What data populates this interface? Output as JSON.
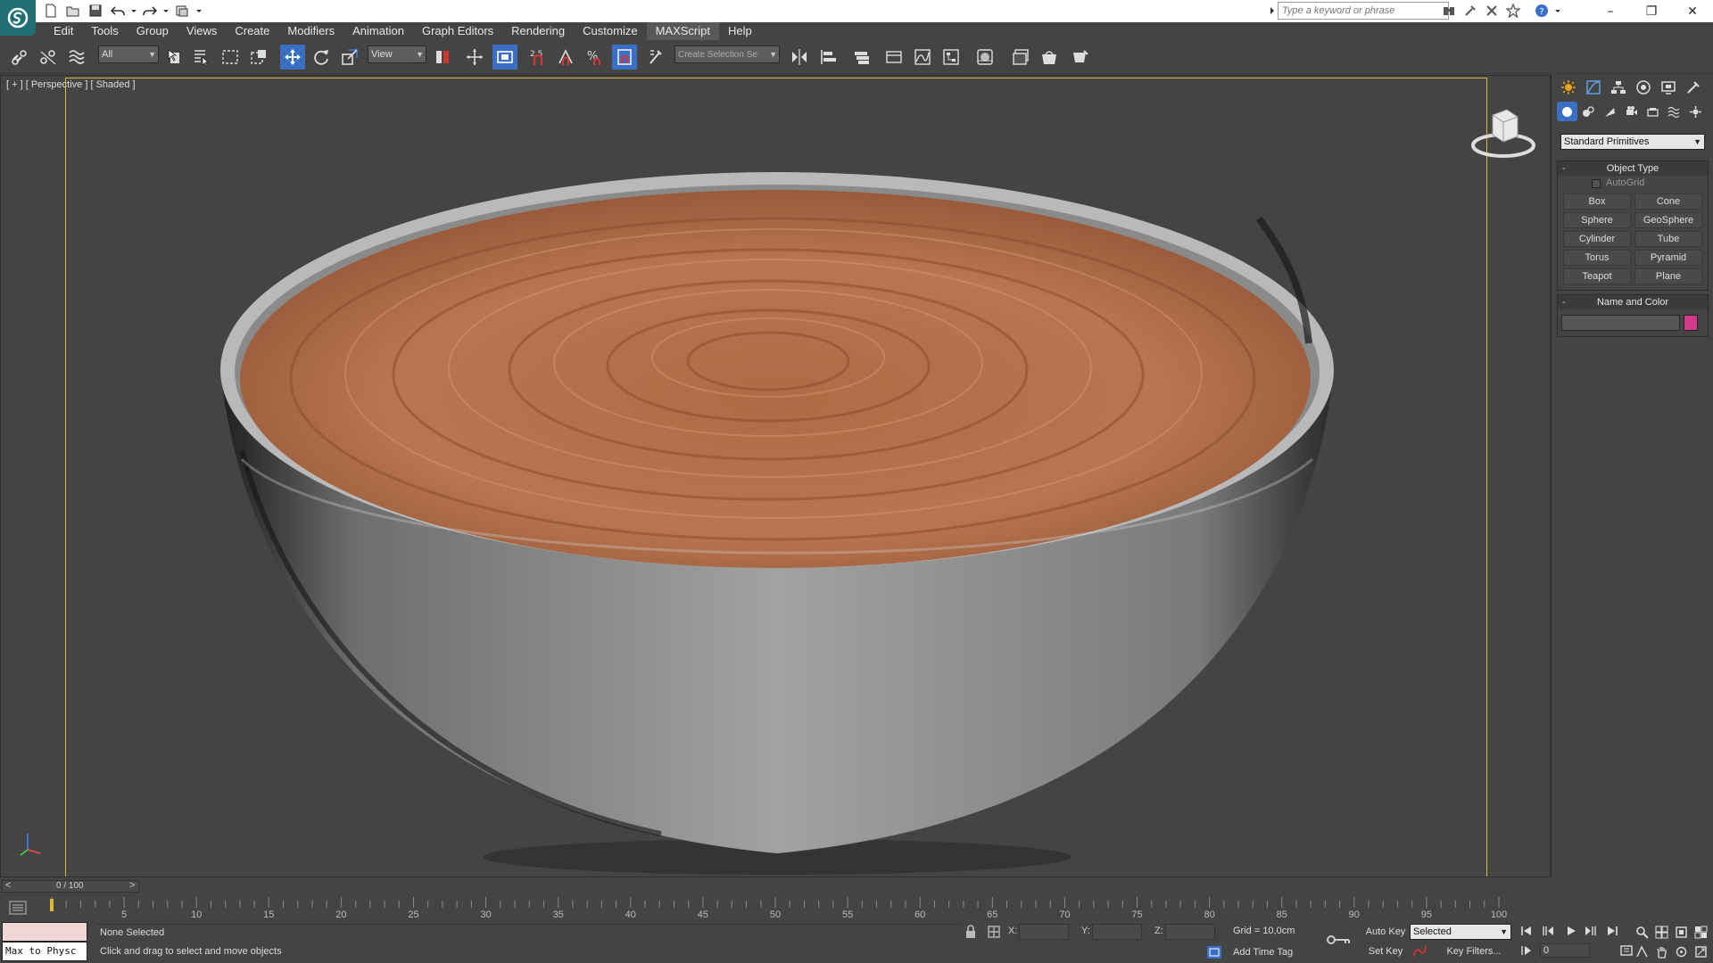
{
  "titlebar": {
    "search_placeholder": "Type a keyword or phrase",
    "window_minimize": "–",
    "window_restore": "❐",
    "window_close": "✕"
  },
  "menu": {
    "items": [
      "Edit",
      "Tools",
      "Group",
      "Views",
      "Create",
      "Modifiers",
      "Animation",
      "Graph Editors",
      "Rendering",
      "Customize",
      "MAXScript",
      "Help"
    ]
  },
  "toolbar": {
    "selection_filter": "All",
    "reference_coord": "View",
    "snap_angle": "2.5",
    "named_selection_set": "Create Selection Se"
  },
  "viewport": {
    "label": "[ + ] [ Perspective ] [ Shaded ]"
  },
  "command_panel": {
    "category_dropdown": "Standard Primitives",
    "object_type": {
      "title": "Object Type",
      "autogrid_label": "AutoGrid",
      "autogrid_checked": false,
      "buttons": [
        "Box",
        "Cone",
        "Sphere",
        "GeoSphere",
        "Cylinder",
        "Tube",
        "Torus",
        "Pyramid",
        "Teapot",
        "Plane"
      ]
    },
    "name_and_color": {
      "title": "Name and Color",
      "color": "#d23a8a"
    }
  },
  "timeline": {
    "slider_label": "0 / 100",
    "slider_left": "<",
    "slider_right": ">",
    "ticks": [
      "5",
      "10",
      "15",
      "20",
      "25",
      "30",
      "35",
      "40",
      "45",
      "50",
      "55",
      "60",
      "65",
      "70",
      "75",
      "80",
      "85",
      "90",
      "95",
      "100"
    ]
  },
  "status": {
    "maxscript_text": "Max to Physc",
    "selection": "None Selected",
    "prompt": "Click and drag to select and move objects",
    "x_label": "X:",
    "y_label": "Y:",
    "z_label": "Z:",
    "grid": "Grid = 10,0cm",
    "add_time_tag": "Add Time Tag"
  },
  "anim": {
    "auto_key": "Auto Key",
    "set_key": "Set Key",
    "key_mode": "Selected",
    "key_filters": "Key Filters...",
    "current_frame": "0"
  },
  "colors": {
    "accent_blue": "#3a6fc4",
    "viewport_border": "#d9b73a",
    "background": "#444444",
    "mousse": "#b5704a",
    "bowl": "#8e8e8e"
  }
}
